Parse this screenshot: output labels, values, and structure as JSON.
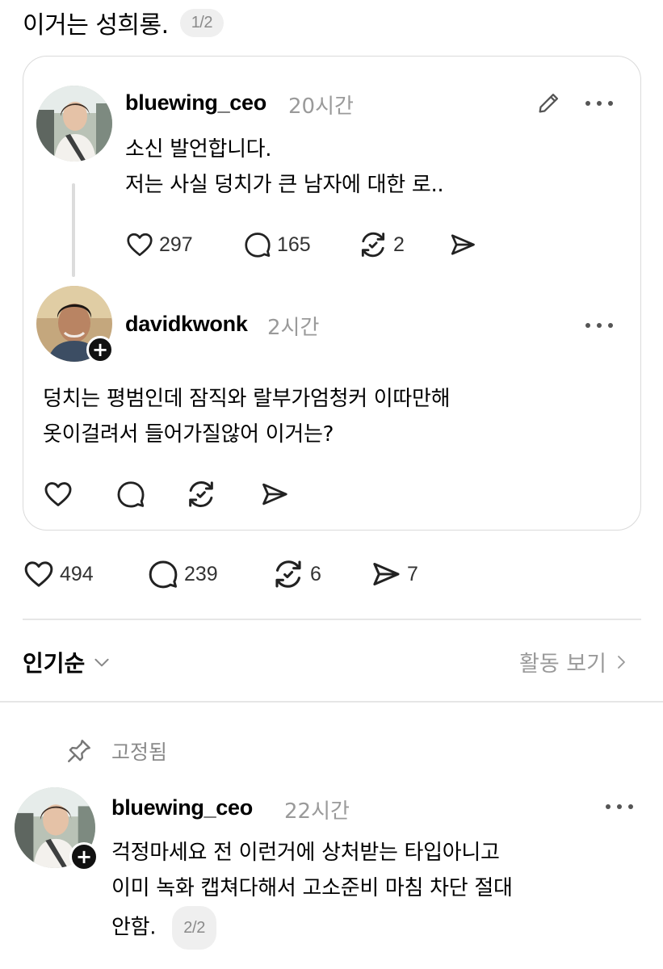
{
  "header": {
    "text": "이거는 성희롱.",
    "page_indicator": "1/2"
  },
  "quoted_post": {
    "username": "bluewing_ceo",
    "time": "20시간",
    "lines": [
      "소신 발언합니다.",
      "저는 사실 덩치가 큰 남자에 대한 로.."
    ],
    "likes": "297",
    "comments": "165",
    "reposts": "2"
  },
  "reply_in_card": {
    "username": "davidkwonk",
    "time": "2시간",
    "lines": [
      "덩치는 평범인데 잠직와 랄부가엄청커 이따만해",
      "옷이걸려서 들어가질않어 이거는?"
    ]
  },
  "main_actions": {
    "likes": "494",
    "comments": "239",
    "reposts": "6",
    "shares": "7"
  },
  "sort": {
    "label": "인기순",
    "activity_link": "활동 보기"
  },
  "pinned_reply": {
    "pinned_label": "고정됨",
    "username": "bluewing_ceo",
    "time": "22시간",
    "lines": [
      "걱정마세요 전 이런거에 상처받는 타입아니고",
      "이미 녹화 캡쳐다해서 고소준비 마침 차단 절대",
      "안함."
    ],
    "page_indicator": "2/2"
  },
  "icons": {
    "like": "heart-icon",
    "comment": "speech-bubble-icon",
    "repost": "repost-arrows-icon",
    "share": "send-plane-icon",
    "edit": "pencil-icon",
    "more": "more-dots-icon",
    "pin": "pin-icon",
    "sort": "chevron-down-icon",
    "activity": "chevron-right-icon",
    "follow": "plus-icon"
  }
}
